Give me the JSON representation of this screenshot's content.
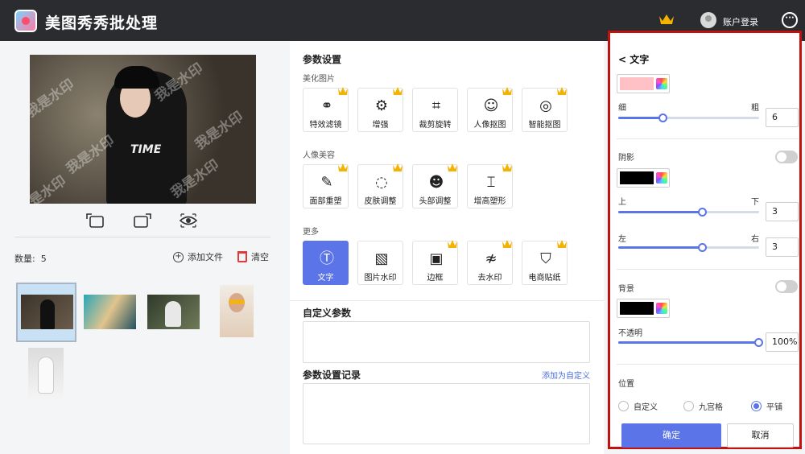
{
  "app": {
    "title": "美图秀秀批处理",
    "login": "账户登录"
  },
  "left": {
    "count_label": "数量:",
    "count_value": "5",
    "add_file": "添加文件",
    "clear": "清空",
    "watermark_text": "我是水印",
    "shirt_text": "TIME"
  },
  "middle": {
    "param_title": "参数设置",
    "beautify_title": "美化图片",
    "beautify_tiles": [
      "特效滤镜",
      "增强",
      "裁剪旋转",
      "人像抠图",
      "智能抠图"
    ],
    "portrait_title": "人像美容",
    "portrait_tiles": [
      "面部重塑",
      "皮肤调整",
      "头部调整",
      "增高塑形"
    ],
    "more_title": "更多",
    "more_tiles": [
      "文字",
      "图片水印",
      "边框",
      "去水印",
      "电商贴纸"
    ],
    "custom_title": "自定义参数",
    "record_title": "参数设置记录",
    "add_custom_link": "添加为自定义"
  },
  "right": {
    "back_title": "< 文字",
    "text_color": "#ffc0c6",
    "thin": "细",
    "bold": "粗",
    "weight_value": "6",
    "weight_fraction": 0.32,
    "shadow_label": "阴影",
    "shadow_color": "#000000",
    "up": "上",
    "down": "下",
    "vertical_value": "3",
    "vertical_fraction": 0.6,
    "left": "左",
    "right": "右",
    "horizontal_value": "3",
    "horizontal_fraction": 0.6,
    "bg_label": "背景",
    "bg_color": "#000000",
    "opacity_label": "不透明",
    "opacity_value": "100%",
    "opacity_fraction": 1.0,
    "position_label": "位置",
    "position_options": [
      "自定义",
      "九宫格",
      "平铺"
    ],
    "position_selected": "平铺",
    "ok": "确定",
    "cancel": "取消"
  },
  "colors": {
    "accent": "#5b74e8",
    "highlight_border": "#c1120f",
    "topbar": "#2b2c30"
  }
}
